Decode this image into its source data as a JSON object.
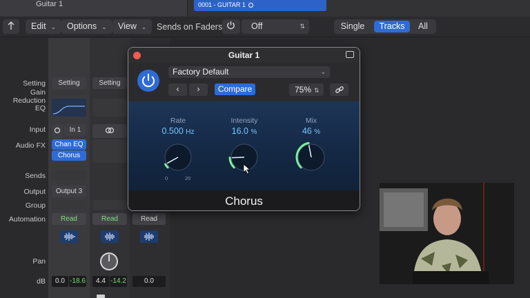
{
  "top": {
    "track_name": "Guitar 1",
    "region_label": "0001 - GUITAR 1"
  },
  "toolbar": {
    "edit": "Edit",
    "options": "Options",
    "view": "View",
    "sends_on_faders_label": "Sends on Faders:",
    "sends_value": "Off",
    "view_modes": [
      "Single",
      "Tracks",
      "All"
    ],
    "active_mode": "Tracks"
  },
  "row_labels": {
    "setting": "Setting",
    "gain_reduction": "Gain Reduction",
    "eq": "EQ",
    "input": "Input",
    "audio_fx": "Audio FX",
    "sends": "Sends",
    "output": "Output",
    "group": "Group",
    "automation": "Automation",
    "pan": "Pan",
    "db": "dB"
  },
  "strip1": {
    "setting": "Setting",
    "input": "In 1",
    "fx1": "Chan EQ",
    "fx2": "Chorus",
    "output": "Output 3",
    "automation": "Read",
    "db_volume": "0.0",
    "db_peak": "-18.6"
  },
  "strip2": {
    "setting": "Setting",
    "automation": "Read",
    "db_volume": "4.4",
    "db_peak": "-14.2"
  },
  "strip3": {
    "automation": "Read",
    "db_volume": "0.0"
  },
  "plugin": {
    "window_title": "Guitar 1",
    "preset": "Factory Default",
    "compare": "Compare",
    "zoom": "75%",
    "name": "Chorus",
    "knobs": [
      {
        "label": "Rate",
        "value": "0.500",
        "unit": "Hz",
        "fraction": 0.06,
        "scale_min": "0",
        "scale_max": "20"
      },
      {
        "label": "Intensity",
        "value": "16.0",
        "unit": "%",
        "fraction": 0.16
      },
      {
        "label": "Mix",
        "value": "46",
        "unit": "%",
        "fraction": 0.46
      }
    ],
    "accent_color": "#2e6bd6",
    "knob_value_color": "#79c7ff"
  }
}
